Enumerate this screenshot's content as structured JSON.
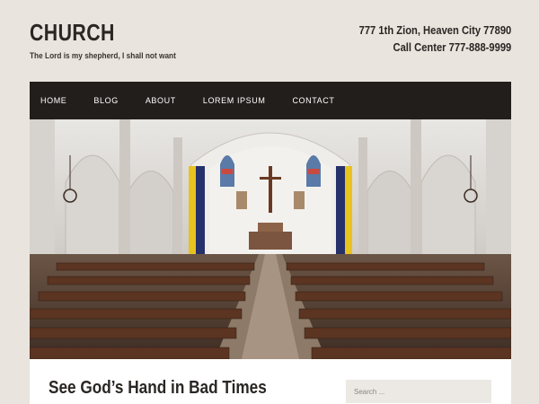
{
  "site": {
    "title": "CHURCH",
    "tagline": "The Lord is my shepherd, I shall not want",
    "address": "777 1th Zion, Heaven City 77890",
    "phone": "Call Center 777-888-9999"
  },
  "nav": {
    "items": [
      {
        "label": "HOME"
      },
      {
        "label": "BLOG"
      },
      {
        "label": "ABOUT"
      },
      {
        "label": "LOREM IPSUM"
      },
      {
        "label": "CONTACT"
      }
    ]
  },
  "hero": {
    "image": "church-interior-photo"
  },
  "post": {
    "title": "See God’s Hand in Bad Times"
  },
  "search": {
    "placeholder": "Search ..."
  },
  "colors": {
    "background": "#e9e4de",
    "nav": "#221e1c",
    "text": "#2a2623"
  }
}
